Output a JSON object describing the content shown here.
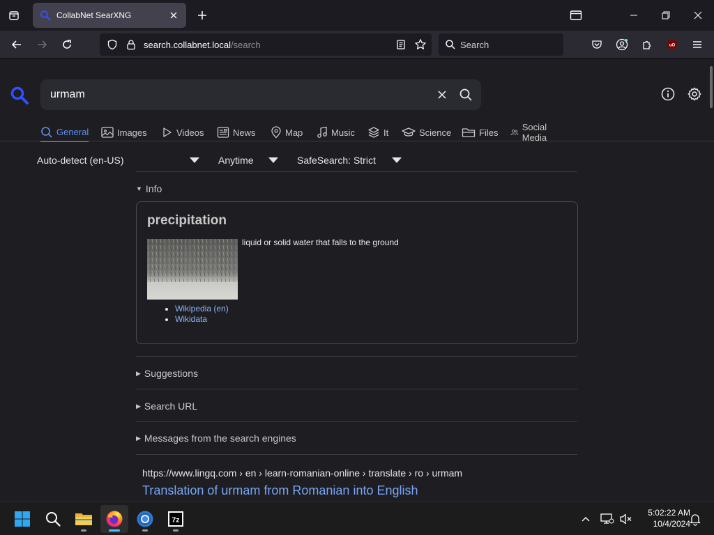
{
  "browser": {
    "tab_title": "CollabNet SearXNG",
    "url_host": "search.collabnet.local",
    "url_path": "/search",
    "search_placeholder": "Search"
  },
  "searx": {
    "query": "urmam",
    "categories": [
      {
        "label": "General",
        "icon": "search-icon",
        "active": true
      },
      {
        "label": "Images",
        "icon": "image-icon"
      },
      {
        "label": "Videos",
        "icon": "play-icon"
      },
      {
        "label": "News",
        "icon": "newspaper-icon"
      },
      {
        "label": "Map",
        "icon": "map-pin-icon"
      },
      {
        "label": "Music",
        "icon": "music-note-icon"
      },
      {
        "label": "It",
        "icon": "layers-icon"
      },
      {
        "label": "Science",
        "icon": "graduation-cap-icon"
      },
      {
        "label": "Files",
        "icon": "folder-icon"
      },
      {
        "label": "Social Media",
        "icon": "people-icon"
      }
    ],
    "filters": {
      "language": "Auto-detect (en-US)",
      "time": "Anytime",
      "safesearch": "SafeSearch: Strict"
    },
    "info_label": "Info",
    "infobox": {
      "title": "precipitation",
      "description": "liquid or solid water that falls to the ground",
      "links": [
        "Wikipedia (en)",
        "Wikidata"
      ]
    },
    "sections": [
      "Suggestions",
      "Search URL",
      "Messages from the search engines"
    ],
    "result": {
      "url": "https://www.lingq.com  › en › learn-romanian-online › translate › ro › urmam",
      "title": "Translation of urmam from Romanian into English"
    }
  },
  "taskbar": {
    "time": "5:02:22 AM",
    "date": "10/4/2024",
    "apps": [
      "start-icon",
      "search-icon",
      "file-explorer-icon",
      "firefox-icon",
      "chrome-icon",
      "7zip-icon"
    ]
  },
  "colors": {
    "accent": "#5d8ef0",
    "link": "#79a6f6",
    "background": "#1e1e22"
  }
}
